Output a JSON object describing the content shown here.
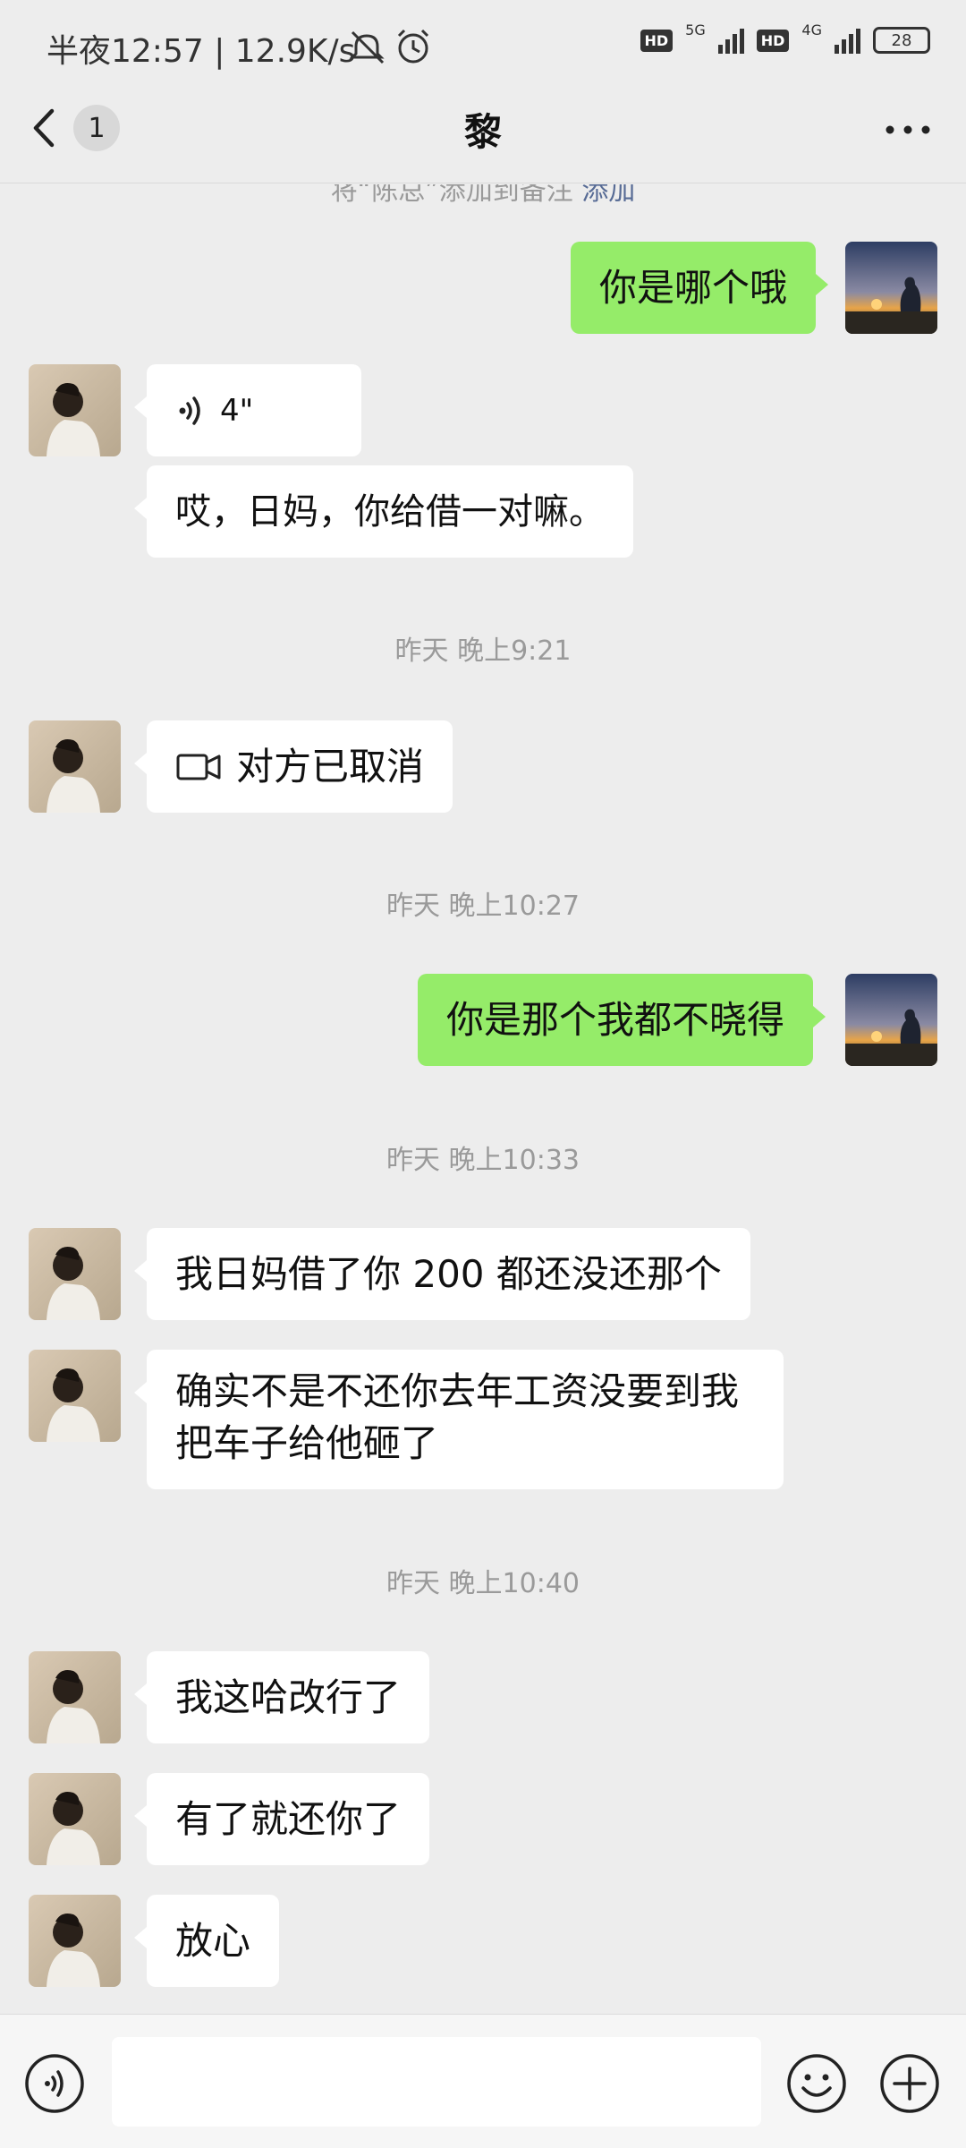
{
  "status_bar": {
    "time": "半夜12:57 | 12.9K/s",
    "hd1": "HD",
    "net1": "5G",
    "hd2": "HD",
    "net2": "4G",
    "battery": "28"
  },
  "header": {
    "unread": "1",
    "title": "黎"
  },
  "remark_banner": {
    "text": "将“陈总”添加到备注 ",
    "link": "添加"
  },
  "messages": [
    {
      "side": "right",
      "text": "你是哪个哦"
    },
    {
      "side": "left",
      "type": "voice",
      "duration": "4\""
    },
    {
      "side": "left",
      "text": "哎，日妈，你给借一对嘛。"
    },
    {
      "type": "time",
      "text": "昨天 晚上9:21"
    },
    {
      "side": "left",
      "type": "video-call",
      "text": "对方已取消"
    },
    {
      "type": "time",
      "text": "昨天 晚上10:27"
    },
    {
      "side": "right",
      "text": "你是那个我都不晓得"
    },
    {
      "type": "time",
      "text": "昨天 晚上10:33"
    },
    {
      "side": "left",
      "text": "我日妈借了你 200 都还没还那个"
    },
    {
      "side": "left",
      "text": "确实不是不还你去年工资没要到我把车子给他砸了"
    },
    {
      "type": "time",
      "text": "昨天 晚上10:40"
    },
    {
      "side": "left",
      "text": "我这哈改行了"
    },
    {
      "side": "left",
      "text": "有了就还你了"
    },
    {
      "side": "left",
      "text": "放心"
    }
  ],
  "input": {
    "value": ""
  },
  "colors": {
    "background": "#ededed",
    "sent_bubble": "#95ec69",
    "received_bubble": "#ffffff",
    "timestamp": "#9a9a9a",
    "link": "#576b95"
  }
}
